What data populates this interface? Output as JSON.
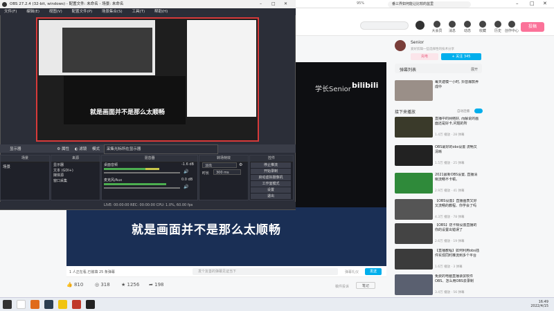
{
  "browser": {
    "url_text": "番三界如何能让比较的盆里",
    "zoom": "95%"
  },
  "site_nav": {
    "items": [
      "大会员",
      "消息",
      "动态",
      "收藏",
      "历史",
      "创作中心"
    ],
    "upload": "投稿"
  },
  "video": {
    "subtitle": "就是画面并不是那么太顺畅",
    "watermark": "学长Senior",
    "viewers": "1 人正在看,已装填 25 条弹幕",
    "danmaku_placeholder": "发个友善的弹幕见证当下",
    "danmaku_etiquette": "弹幕礼仪",
    "send_label": "发送",
    "likes": "810",
    "coins": "318",
    "favorites": "1256",
    "shares": "198",
    "report": "稿件投诉",
    "note": "笔记"
  },
  "uploader": {
    "name": "Senior",
    "desc": "爱好剪辑一些选择性的技术分享",
    "charge_label": "充电",
    "follow_label": "+ 关注 345"
  },
  "danmaku_list": {
    "title": "弹幕列表",
    "action": "展开"
  },
  "autoplay": {
    "label": "接下来播放",
    "toggle": "自动连播"
  },
  "recommendations": [
    {
      "title": "每天建模一小时, 抖音爆款养成中",
      "meta": ""
    },
    {
      "title": "直播中的网络好, 而解说的画面还是好卡,问题的所",
      "meta": "1.4万 播放 · 28 弹幕"
    },
    {
      "title": "OBS最好的obs设置 流畅又清晰",
      "meta": "1.5万 播放 · 25 弹幕"
    },
    {
      "title": "2021最新OBS设置, 直播清晰流畅不卡顿。",
      "meta": "2.9万 播放 · 41 弹幕"
    },
    {
      "title": "【OBS设置】直播画质又好又流畅的教程、你学会了吗",
      "meta": "4.3万 播放 · 78 弹幕"
    },
    {
      "title": "【OBS】防卡顿设置直播的 你的设置出错误了",
      "meta": "2.6万 播放 · 19 弹幕"
    },
    {
      "title": "【直播教程】如何利用obs插件实现同时推流到多个平台",
      "meta": "1.6万 播放 · 3 弹幕"
    },
    {
      "title": "免费的电脑直播录屏软件OBS、怎么用OBS去录制",
      "meta": "3.4万 播放 · 56 弹幕"
    }
  ],
  "obs": {
    "title": "OBS 27.2.4 (32-bit, windows) - 配置文件: 未命名 - 场景: 未命名",
    "menu": [
      "文件(F)",
      "编辑(E)",
      "视图(V)",
      "配置文件(P)",
      "场景集合(S)",
      "工具(T)",
      "帮助(H)"
    ],
    "toolbar": {
      "source_label": "显示器",
      "properties": "属性",
      "filters": "滤镜",
      "mode": "模式",
      "mode_value": "采集光标所在显示器"
    },
    "docks": {
      "scenes": "场景",
      "sources": "来源",
      "mixer": "混音器",
      "transitions": "转场特效",
      "controls": "控件"
    },
    "scene_items": [
      "场景"
    ],
    "source_items": [
      "显示器",
      "文本 (GDI+)",
      "媒体源",
      "窗口采集"
    ],
    "mixer_channels": [
      {
        "name": "桌面音频",
        "db": "-1.6 dB"
      },
      {
        "name": "麦克风/Aux",
        "db": "0.0 dB"
      }
    ],
    "transition": {
      "type": "淡出",
      "duration_label": "时长",
      "duration": "300 ms"
    },
    "controls": [
      "停止推流",
      "开始录制",
      "启动虚拟摄像机",
      "工作室模式",
      "设置",
      "退出"
    ],
    "status": "LIVE: 00:00:00  REC: 00:00:00  CPU: 1.0%, 60.00 fps"
  },
  "taskbar": {
    "time": "16:49",
    "date": "2022/4/15"
  },
  "colors": {
    "accent_pink": "#fb7299",
    "accent_blue": "#00aeec",
    "obs_dark": "#2b2e38",
    "record_red": "#d83a3a"
  }
}
